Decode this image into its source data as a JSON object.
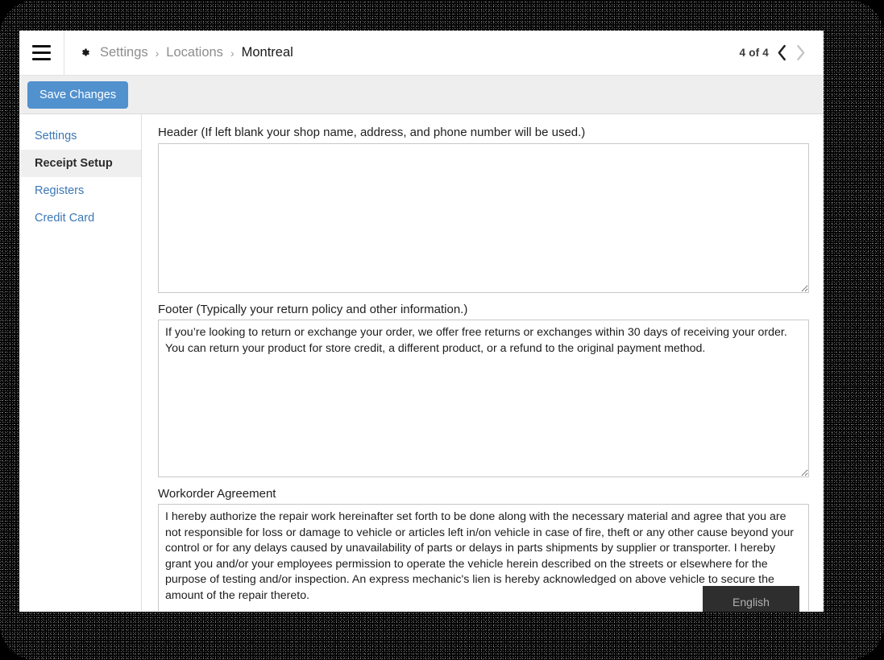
{
  "topbar": {
    "menu_icon": "hamburger-icon",
    "gear_icon": "gear-icon",
    "breadcrumb": {
      "items": [
        {
          "label": "Settings",
          "current": false
        },
        {
          "label": "Locations",
          "current": false
        },
        {
          "label": "Montreal",
          "current": true
        }
      ],
      "separator": "›"
    },
    "pager": {
      "label": "4 of 4",
      "prev_icon": "chevron-left-icon",
      "next_icon": "chevron-right-icon"
    }
  },
  "toolbar": {
    "save_label": "Save Changes",
    "save_color": "#5191ce"
  },
  "sidebar": {
    "items": [
      {
        "label": "Settings"
      },
      {
        "label": "Receipt Setup"
      },
      {
        "label": "Registers"
      },
      {
        "label": "Credit Card"
      }
    ],
    "active_index": 1,
    "link_color": "#3b77b5",
    "active_bg": "#efefef"
  },
  "main": {
    "header_field": {
      "label": "Header (If left blank your shop name, address, and phone number will be used.)",
      "value": "",
      "placeholder": ""
    },
    "footer_field": {
      "label": "Footer (Typically your return policy and other information.)",
      "value": "If you’re looking to return or exchange your order, we offer free returns or exchanges within 30 days of receiving your order. You can return your product for store credit, a different product, or a refund to the original payment method.",
      "placeholder": ""
    },
    "workorder_field": {
      "label": "Workorder Agreement",
      "value": "I hereby authorize the repair work hereinafter set forth to be done along with the necessary material and agree that you are not responsible for loss or damage to vehicle or articles left in/on vehicle in case of fire, theft or any other cause beyond your control or for any delays caused by unavailability of parts or delays in parts shipments by supplier or transporter. I hereby grant you and/or your employees permission to operate the vehicle herein described on the streets or elsewhere for the purpose of testing and/or inspection. An express mechanic's lien is hereby acknowledged on above vehicle to secure the amount of the repair thereto.",
      "placeholder": ""
    },
    "language_button": {
      "label": "English"
    }
  }
}
